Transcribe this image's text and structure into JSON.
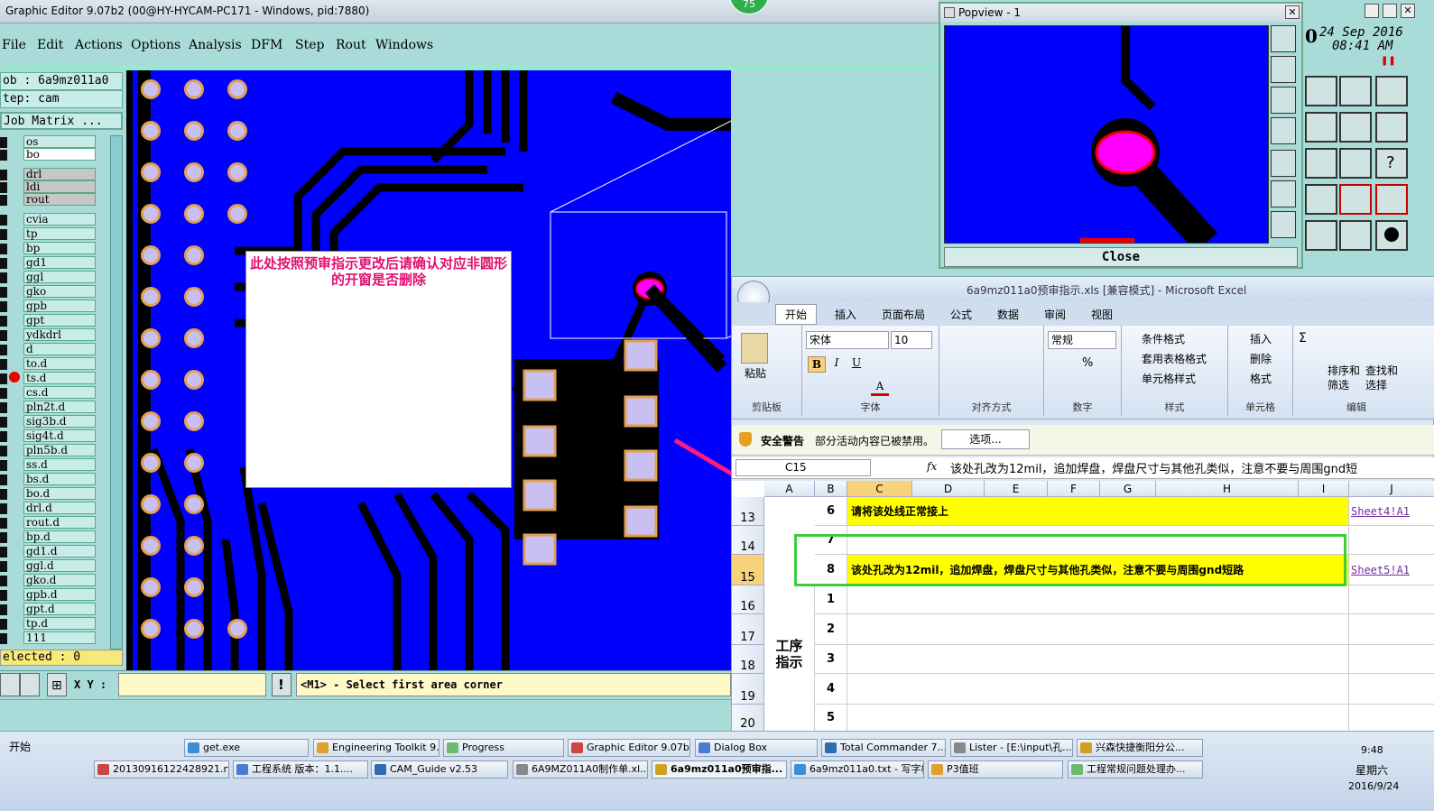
{
  "window": {
    "title": "Graphic Editor 9.07b2 (00@HY-HYCAM-PC171 - Windows, pid:7880)",
    "badge": "75"
  },
  "menu": [
    "File",
    "Edit",
    "Actions",
    "Options",
    "Analysis",
    "DFM",
    "Step",
    "Rout",
    "Windows"
  ],
  "info": {
    "job": "ob : 6a9mz011a0",
    "step": "tep: cam",
    "matrix": "Job Matrix ..."
  },
  "layers": [
    "os",
    "bo",
    "drl",
    "ldi",
    "rout",
    "cvia",
    "tp",
    "bp",
    "gd1",
    "ggl",
    "gko",
    "gpb",
    "gpt",
    "ydkdrl",
    "d",
    "to.d",
    "ts.d",
    "cs.d",
    "pln2t.d",
    "sig3b.d",
    "sig4t.d",
    "pln5b.d",
    "ss.d",
    "bs.d",
    "bo.d",
    "drl.d",
    "rout.d",
    "bp.d",
    "gd1.d",
    "ggl.d",
    "gko.d",
    "gpb.d",
    "gpt.d",
    "tp.d",
    "111"
  ],
  "selected": "elected : 0",
  "note": "此处按照预审指示更改后请确认对应非圆形的开窗是否删除",
  "status": {
    "xy_label": "X Y :",
    "xy_value": "",
    "message": "<M1> - Select first area corner"
  },
  "popview": {
    "title": "Popview - 1",
    "close": "Close"
  },
  "clock": {
    "date": "24 Sep 2016",
    "time": "08:41 AM",
    "zero": "0"
  },
  "excel": {
    "title": "6a9mz011a0预审指示.xls  [兼容模式] - Microsoft Excel",
    "tabs": [
      "开始",
      "插入",
      "页面布局",
      "公式",
      "数据",
      "审阅",
      "视图"
    ],
    "ribbon": {
      "paste": "粘贴",
      "clipboard": "剪贴板",
      "font_name": "宋体",
      "font_size": "10",
      "font": "字体",
      "align": "对齐方式",
      "number_format": "常规",
      "number": "数字",
      "cond": "条件格式",
      "table": "套用表格格式",
      "cellstyle": "单元格样式",
      "style": "样式",
      "insert": "插入",
      "delete": "删除",
      "format": "格式",
      "cells": "单元格",
      "sort": "排序和筛选",
      "find": "查找和选择",
      "edit": "编辑"
    },
    "security": {
      "label": "安全警告",
      "text": "部分活动内容已被禁用。",
      "button": "选项..."
    },
    "namebox": "C15",
    "formula": "该处孔改为12mil，追加焊盘，焊盘尺寸与其他孔类似，注意不要与周围gnd短",
    "columns": [
      "A",
      "B",
      "C",
      "D",
      "E",
      "F",
      "G",
      "H",
      "I",
      "J"
    ],
    "rows": [
      {
        "num": "13",
        "b": "6",
        "c": "请将该处线正常接上",
        "j": "Sheet4!A1"
      },
      {
        "num": "14",
        "b": "7",
        "c": "",
        "j": ""
      },
      {
        "num": "15",
        "b": "8",
        "c": "该处孔改为12mil，追加焊盘，焊盘尺寸与其他孔类似，注意不要与周围gnd短路",
        "j": "Sheet5!A1"
      },
      {
        "num": "16",
        "b": "1",
        "c": "",
        "j": ""
      },
      {
        "num": "17",
        "b": "2",
        "c": "",
        "j": ""
      },
      {
        "num": "18",
        "b": "3",
        "c": "",
        "j": ""
      },
      {
        "num": "19",
        "b": "4",
        "c": "",
        "j": ""
      },
      {
        "num": "20",
        "b": "5",
        "c": "",
        "j": ""
      }
    ],
    "merged_label": "工序指示"
  },
  "taskbar": {
    "start": "开始",
    "row1": [
      "get.exe",
      "Engineering Toolkit 9....",
      "Progress",
      "Graphic Editor 9.07b...",
      "Dialog Box",
      "Total Commander 7....",
      "Lister - [E:\\input\\孔...",
      "兴森快捷衡阳分公..."
    ],
    "row2": [
      "20130916122428921.rt...",
      "工程系统  版本：1.1....",
      "CAM_Guide v2.53",
      "6A9MZ011A0制作单.xl...",
      "6a9mz011a0预审指...",
      "6a9mz011a0.txt - 写字板",
      "P3值班",
      "工程常规问题处理办..."
    ],
    "time": "9:48",
    "weekday": "星期六",
    "date": "2016/9/24"
  }
}
